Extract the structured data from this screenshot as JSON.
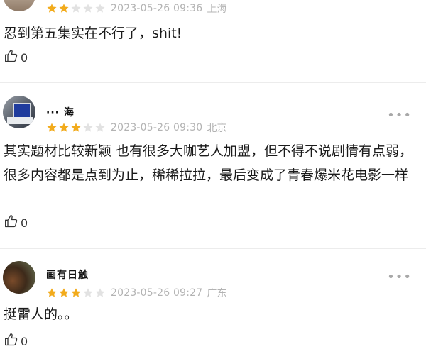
{
  "reviews": [
    {
      "name": "",
      "rating": 2,
      "date": "2023-05-26 09:36",
      "location": "上海",
      "content": "忍到第五集实在不行了，shit!",
      "likes": "0",
      "more": "•••"
    },
    {
      "name": "··· 海",
      "rating": 3,
      "date": "2023-05-26 09:30",
      "location": "北京",
      "content": "其实题材比较新颖 也有很多大咖艺人加盟，但不得不说剧情有点弱，很多内容都是点到为止，稀稀拉拉，最后变成了青春爆米花电影一样",
      "likes": "0",
      "more": "•••"
    },
    {
      "name": "画有日触",
      "rating": 3,
      "date": "2023-05-26 09:27",
      "location": "广东",
      "content": "挺雷人的。。",
      "likes": "0",
      "more": "•••"
    }
  ],
  "colors": {
    "star_on": "#f2ab1c",
    "star_off": "#e2e2e2",
    "meta": "#b3b3b3"
  },
  "icons": {
    "like": "thumbs-up-icon",
    "more": "more-dots-icon",
    "star": "star-icon"
  }
}
